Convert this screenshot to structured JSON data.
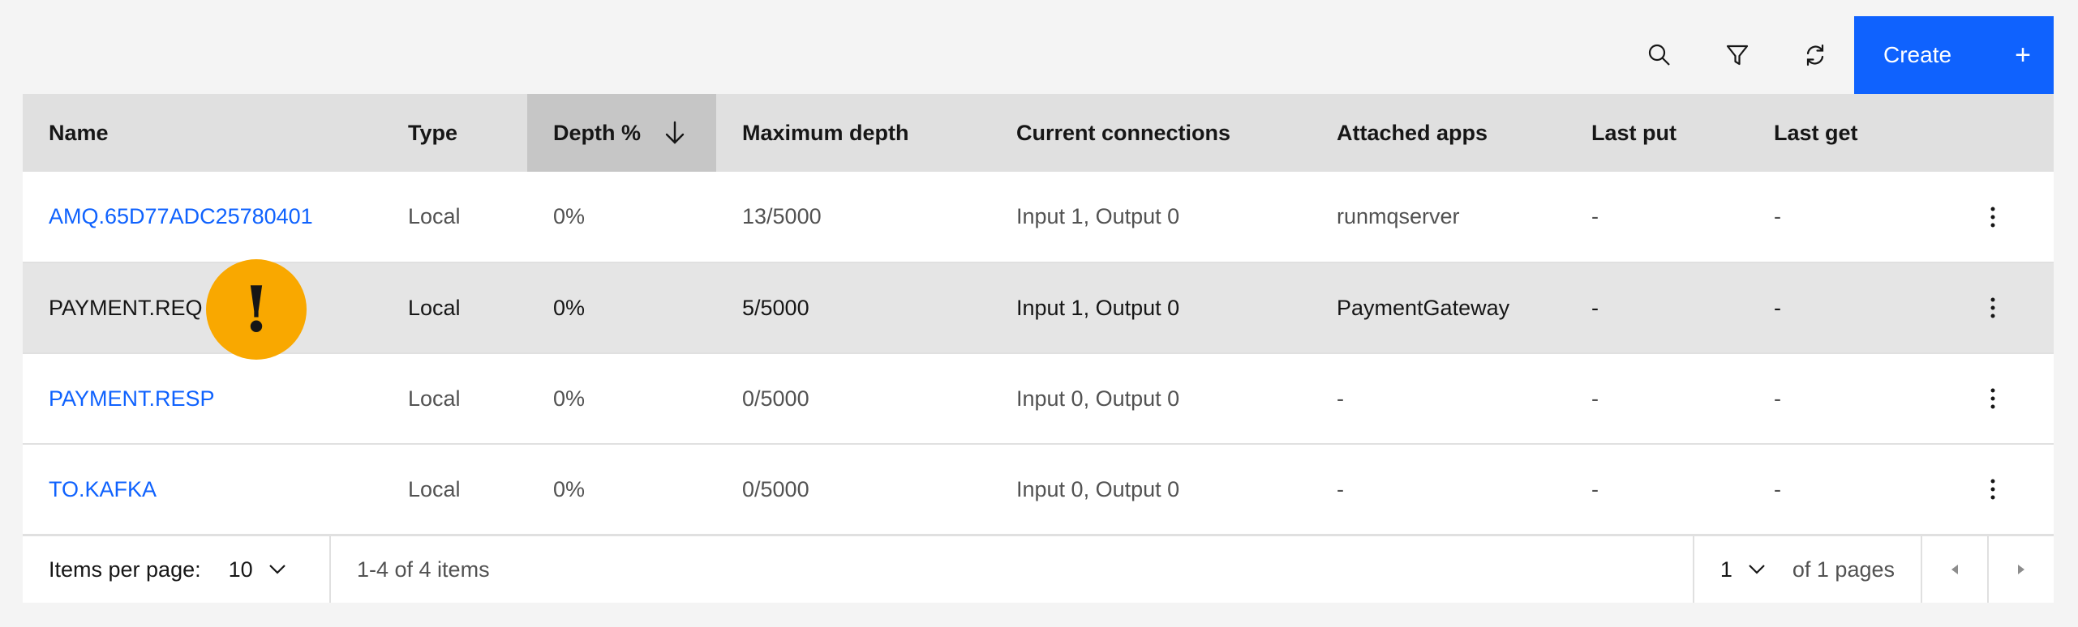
{
  "toolbar": {
    "search_icon": "search-icon",
    "filter_icon": "filter-icon",
    "refresh_icon": "refresh-icon",
    "create_label": "Create",
    "create_plus": "+",
    "accent_color": "#0f62fe"
  },
  "table": {
    "columns": [
      "Name",
      "Type",
      "Depth %",
      "Maximum depth",
      "Current connections",
      "Attached apps",
      "Last put",
      "Last get"
    ],
    "sorted_column": "Depth %",
    "sort_direction": "descending",
    "rows": [
      {
        "name": "AMQ.65D77ADC25780401",
        "type": "Local",
        "depth": "0%",
        "max_depth": "13/5000",
        "connections": "Input 1, Output 0",
        "apps": "runmqserver",
        "last_put": "-",
        "last_get": "-"
      },
      {
        "name": "PAYMENT.REQ",
        "type": "Local",
        "depth": "0%",
        "max_depth": "5/5000",
        "connections": "Input 1, Output 0",
        "apps": "PaymentGateway",
        "last_put": "-",
        "last_get": "-"
      },
      {
        "name": "PAYMENT.RESP",
        "type": "Local",
        "depth": "0%",
        "max_depth": "0/5000",
        "connections": "Input 0, Output 0",
        "apps": "-",
        "last_put": "-",
        "last_get": "-"
      },
      {
        "name": "TO.KAFKA",
        "type": "Local",
        "depth": "0%",
        "max_depth": "0/5000",
        "connections": "Input 0, Output 0",
        "apps": "-",
        "last_put": "-",
        "last_get": "-"
      }
    ]
  },
  "warning_badge": {
    "text": "!",
    "color": "#f9a800"
  },
  "pagination": {
    "items_per_page_label": "Items per page:",
    "items_per_page_value": "10",
    "range_text": "1-4 of 4 items",
    "current_page": "1",
    "of_pages_text": "of 1 pages"
  }
}
